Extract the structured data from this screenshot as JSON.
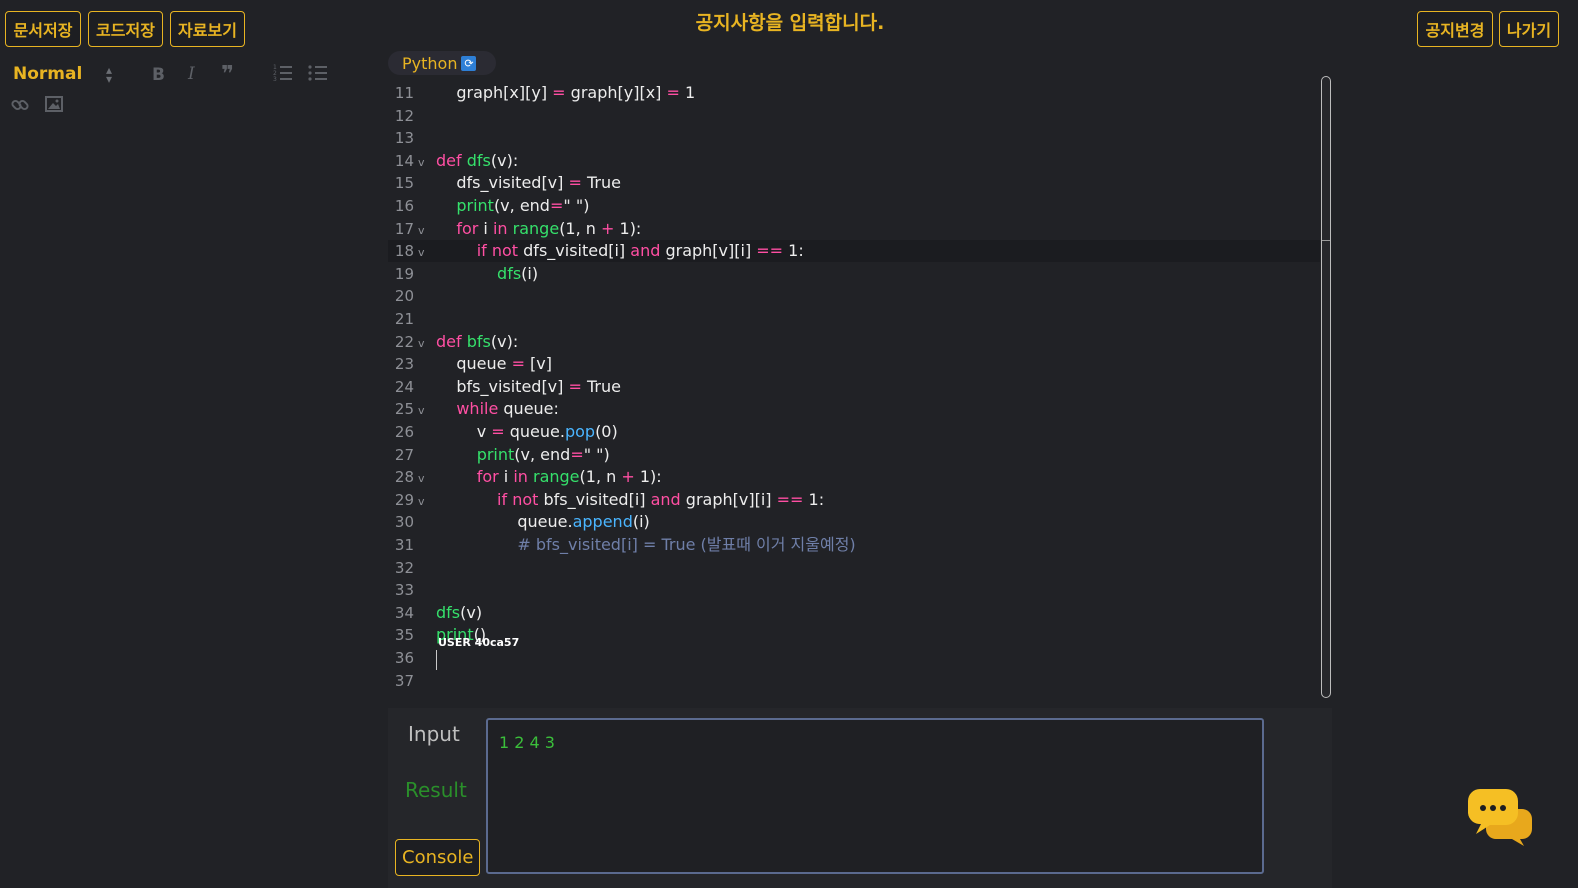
{
  "header": {
    "save_doc": "문서저장",
    "save_code": "코드저장",
    "view_data": "자료보기",
    "notice": "공지사항을 입력합니다.",
    "change_notice": "공지변경",
    "exit": "나가기"
  },
  "toolbar": {
    "format": "Normal",
    "icons": [
      "bold-icon",
      "italic-icon",
      "quote-icon",
      "ordered-list-icon",
      "bullet-list-icon",
      "link-icon",
      "image-icon"
    ]
  },
  "editor": {
    "language": "Python",
    "cursor_user": "USER 40ca57",
    "lines": [
      {
        "n": "11",
        "fold": "",
        "html": "    graph[x][y] <span class=\"op\">=</span> graph[y][x] <span class=\"op\">=</span> 1"
      },
      {
        "n": "12",
        "fold": "",
        "html": ""
      },
      {
        "n": "13",
        "fold": "",
        "html": ""
      },
      {
        "n": "14",
        "fold": "v",
        "html": "<span class=\"kw\">def</span> <span class=\"fn\">dfs</span>(v):"
      },
      {
        "n": "15",
        "fold": "",
        "html": "    dfs_visited[v] <span class=\"op\">=</span> True"
      },
      {
        "n": "16",
        "fold": "",
        "html": "    <span class=\"fn\">print</span>(v, end<span class=\"op\">=</span><span class=\"str\">\" \"</span>)"
      },
      {
        "n": "17",
        "fold": "v",
        "html": "    <span class=\"kw\">for</span> i <span class=\"kw\">in</span> <span class=\"fn\">range</span>(1, n <span class=\"op\">+</span> 1):"
      },
      {
        "n": "18",
        "fold": "v",
        "active": true,
        "html": "        <span class=\"kw\">if not</span> dfs_visited[i] <span class=\"kw\">and</span> graph[v][i] <span class=\"op\">==</span> 1:"
      },
      {
        "n": "19",
        "fold": "",
        "html": "            <span class=\"fn\">dfs</span>(i)"
      },
      {
        "n": "20",
        "fold": "",
        "html": ""
      },
      {
        "n": "21",
        "fold": "",
        "html": ""
      },
      {
        "n": "22",
        "fold": "v",
        "html": "<span class=\"kw\">def</span> <span class=\"fn\">bfs</span>(v):"
      },
      {
        "n": "23",
        "fold": "",
        "html": "    queue <span class=\"op\">=</span> [v]"
      },
      {
        "n": "24",
        "fold": "",
        "html": "    bfs_visited[v] <span class=\"op\">=</span> True"
      },
      {
        "n": "25",
        "fold": "v",
        "html": "    <span class=\"kw\">while</span> queue:"
      },
      {
        "n": "26",
        "fold": "",
        "html": "        v <span class=\"op\">=</span> queue.<span class=\"me\">pop</span>(0)"
      },
      {
        "n": "27",
        "fold": "",
        "html": "        <span class=\"fn\">print</span>(v, end<span class=\"op\">=</span><span class=\"str\">\" \"</span>)"
      },
      {
        "n": "28",
        "fold": "v",
        "html": "        <span class=\"kw\">for</span> i <span class=\"kw\">in</span> <span class=\"fn\">range</span>(1, n <span class=\"op\">+</span> 1):"
      },
      {
        "n": "29",
        "fold": "v",
        "html": "            <span class=\"kw\">if not</span> bfs_visited[i] <span class=\"kw\">and</span> graph[v][i] <span class=\"op\">==</span> 1:"
      },
      {
        "n": "30",
        "fold": "",
        "html": "                queue.<span class=\"me\">append</span>(i)"
      },
      {
        "n": "31",
        "fold": "",
        "html": "                <span class=\"cm\"># bfs_visited[i] = True (발표때 이거 지울예정)</span>"
      },
      {
        "n": "32",
        "fold": "",
        "html": ""
      },
      {
        "n": "33",
        "fold": "",
        "html": ""
      },
      {
        "n": "34",
        "fold": "",
        "html": "<span class=\"fn\">dfs</span>(v)"
      },
      {
        "n": "35",
        "fold": "",
        "html": "<span class=\"fn\">print</span>()"
      },
      {
        "n": "36",
        "fold": "",
        "html": ""
      },
      {
        "n": "37",
        "fold": "",
        "html": ""
      }
    ]
  },
  "io": {
    "input_label": "Input",
    "result_label": "Result",
    "output": "1 2 4 3",
    "console_label": "Console"
  },
  "colors": {
    "accent": "#e8b422",
    "background": "#212226",
    "keyword": "#ff4fa3",
    "function": "#35e06b",
    "method": "#4ab5ff",
    "comment": "#6f7fa8",
    "result": "#3bbf3b"
  }
}
